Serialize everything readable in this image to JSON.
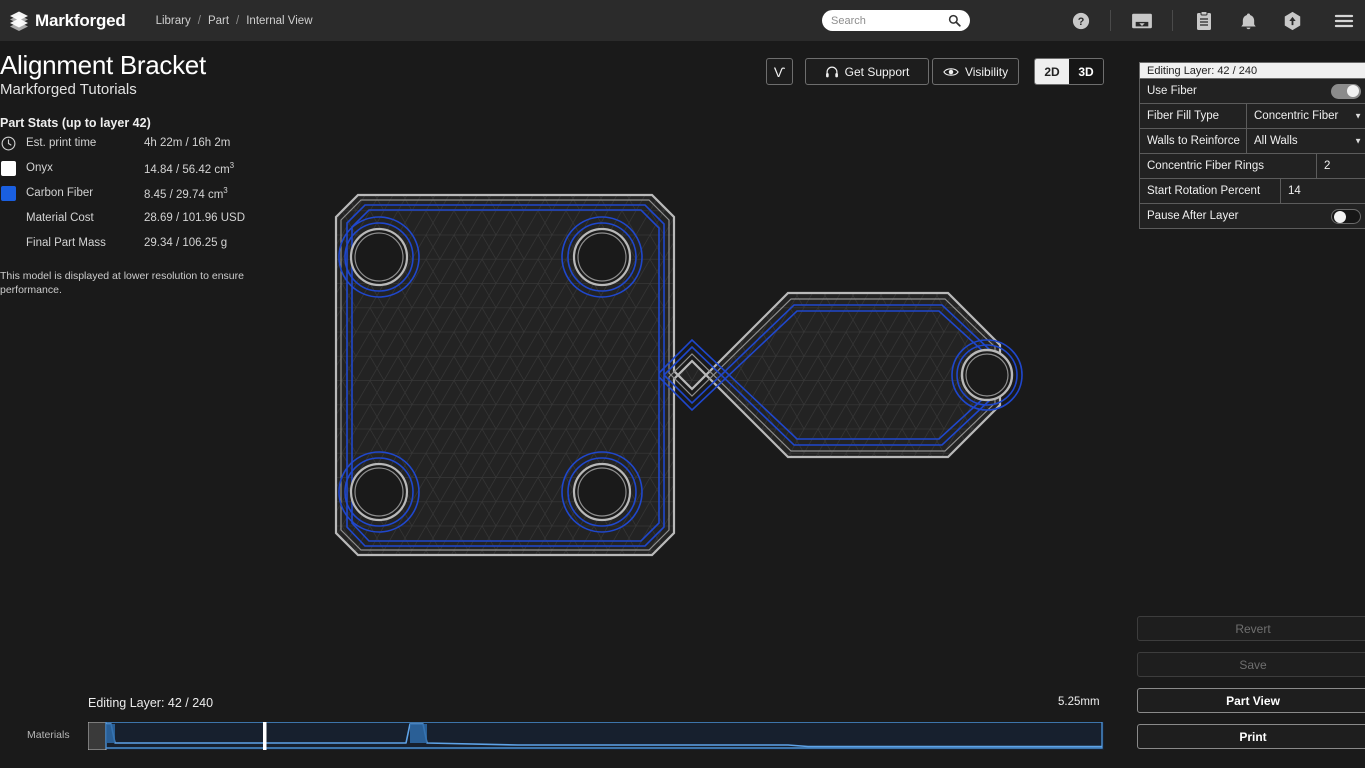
{
  "nav": {
    "brand": "Markforged",
    "brand_icon": "markforged-logo-icon",
    "breadcrumb": [
      "Library",
      "Part",
      "Internal View"
    ],
    "separator": "/",
    "search_placeholder": "Search",
    "search_value": "",
    "search_icon": "search-icon",
    "icons": [
      {
        "name": "help-icon",
        "glyph": "?"
      },
      {
        "name": "printer-icon",
        "glyph": "printer"
      },
      {
        "name": "clipboard-icon",
        "glyph": "clipboard"
      },
      {
        "name": "bell-icon",
        "glyph": "bell"
      },
      {
        "name": "upload-hex-icon",
        "glyph": "hex-up"
      },
      {
        "name": "hamburger-menu-icon",
        "glyph": "menu"
      }
    ]
  },
  "part": {
    "title": "Alignment Bracket",
    "subtitle": "Markforged Tutorials",
    "stats_heading": "Part Stats (up to layer 42)",
    "stats": [
      {
        "icon": "clock-icon",
        "swatch": "",
        "label": "Est. print time",
        "value": "4h 22m / 16h 2m",
        "sup": ""
      },
      {
        "icon": "swatch",
        "swatch": "#ffffff",
        "label": "Onyx",
        "value": "14.84 / 56.42 cm",
        "sup": "3"
      },
      {
        "icon": "swatch",
        "swatch": "#1a5fe0",
        "label": "Carbon Fiber",
        "value": "8.45 / 29.74 cm",
        "sup": "3"
      },
      {
        "icon": "none",
        "swatch": "",
        "label": "Material Cost",
        "value": "28.69 / 101.96 USD",
        "sup": ""
      },
      {
        "icon": "none",
        "swatch": "",
        "label": "Final Part Mass",
        "value": "29.34 / 106.25 g",
        "sup": ""
      }
    ],
    "resolution_note": "This model is displayed at lower resolution to ensure performance."
  },
  "toolbar": {
    "measure_label": "Ѵ",
    "measure_icon": "measure-tool-icon",
    "support_label": "Get Support",
    "support_icon": "headset-icon",
    "visibility_label": "Visibility",
    "visibility_icon": "eye-icon",
    "view_2d": "2D",
    "view_3d": "3D",
    "active_view": "2D"
  },
  "settings_panel": {
    "header": "Editing Layer: 42 / 240",
    "rows": [
      {
        "label": "Use Fiber",
        "type": "toggle",
        "value": "on"
      },
      {
        "label": "Fiber Fill Type",
        "type": "select",
        "value": "Concentric Fiber"
      },
      {
        "label": "Walls to Reinforce",
        "type": "select",
        "value": "All Walls"
      },
      {
        "label": "Concentric Fiber Rings",
        "type": "number",
        "value": "2"
      },
      {
        "label": "Start Rotation Percent",
        "type": "number",
        "value": "14"
      },
      {
        "label": "Pause After Layer",
        "type": "toggle",
        "value": "off"
      }
    ]
  },
  "actions": {
    "revert": "Revert",
    "save": "Save",
    "part_view": "Part View",
    "print": "Print"
  },
  "layer_slider": {
    "editing_layer_label": "Editing Layer: 42 / 240",
    "height_label": "5.25mm",
    "materials_label": "Materials",
    "current_layer": 42,
    "total_layers": 240
  },
  "colors": {
    "accent_blue": "#2a6bd4",
    "fiber_blue": "#1a3fc4",
    "wall_grey": "#b9b9b9",
    "panel_bg": "#222222",
    "nav_bg": "#2b2b2b"
  }
}
